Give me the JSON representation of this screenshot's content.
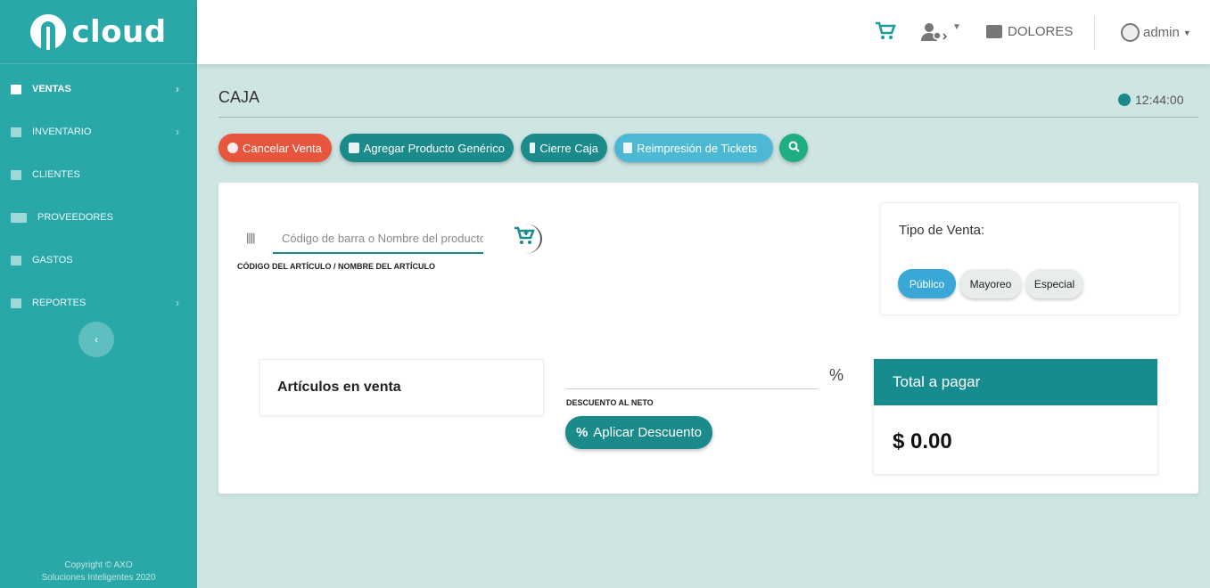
{
  "brand": {
    "name": "cloud"
  },
  "sidebar": {
    "items": [
      {
        "label": "VENTAS",
        "icon": "cart-icon",
        "has_submenu": true
      },
      {
        "label": "INVENTARIO",
        "icon": "box-icon",
        "has_submenu": true
      },
      {
        "label": "CLIENTES",
        "icon": "users-icon",
        "has_submenu": false
      },
      {
        "label": "PROVEEDORES",
        "icon": "truck-icon",
        "has_submenu": false
      },
      {
        "label": "GASTOS",
        "icon": "receipt-icon",
        "has_submenu": false
      },
      {
        "label": "REPORTES",
        "icon": "chart-icon",
        "has_submenu": true
      }
    ],
    "copyright_line1": "Copyright © AXO",
    "copyright_line2": "Soluciones Inteligentes 2020"
  },
  "topbar": {
    "store": "DOLORES",
    "user": "admin"
  },
  "page": {
    "title": "CAJA",
    "time": "12:44:00"
  },
  "actions": {
    "cancel": "Cancelar Venta",
    "generic": "Agregar Producto Genérico",
    "cierre": "Cierre Caja",
    "reimpresion": "Reimpresión de Tickets"
  },
  "search": {
    "placeholder": "Código de barra o Nombre del producto",
    "label": "CÓDIGO DEL ARTÍCULO / NOMBRE DEL ARTÍCULO"
  },
  "tipo_venta": {
    "title": "Tipo de Venta:",
    "options": [
      "Público",
      "Mayoreo",
      "Especial"
    ],
    "selected": "Público"
  },
  "articulos": {
    "title": "Artículos en venta"
  },
  "descuento": {
    "symbol": "%",
    "label": "DESCUENTO AL NETO",
    "button": "Aplicar Descuento"
  },
  "total": {
    "title": "Total a pagar",
    "value": "$ 0.00"
  },
  "colors": {
    "primary": "#1a8a8a",
    "sidebar": "#2aa8a8",
    "danger": "#e8553d",
    "info": "#4db8d4",
    "success": "#1fae82"
  }
}
